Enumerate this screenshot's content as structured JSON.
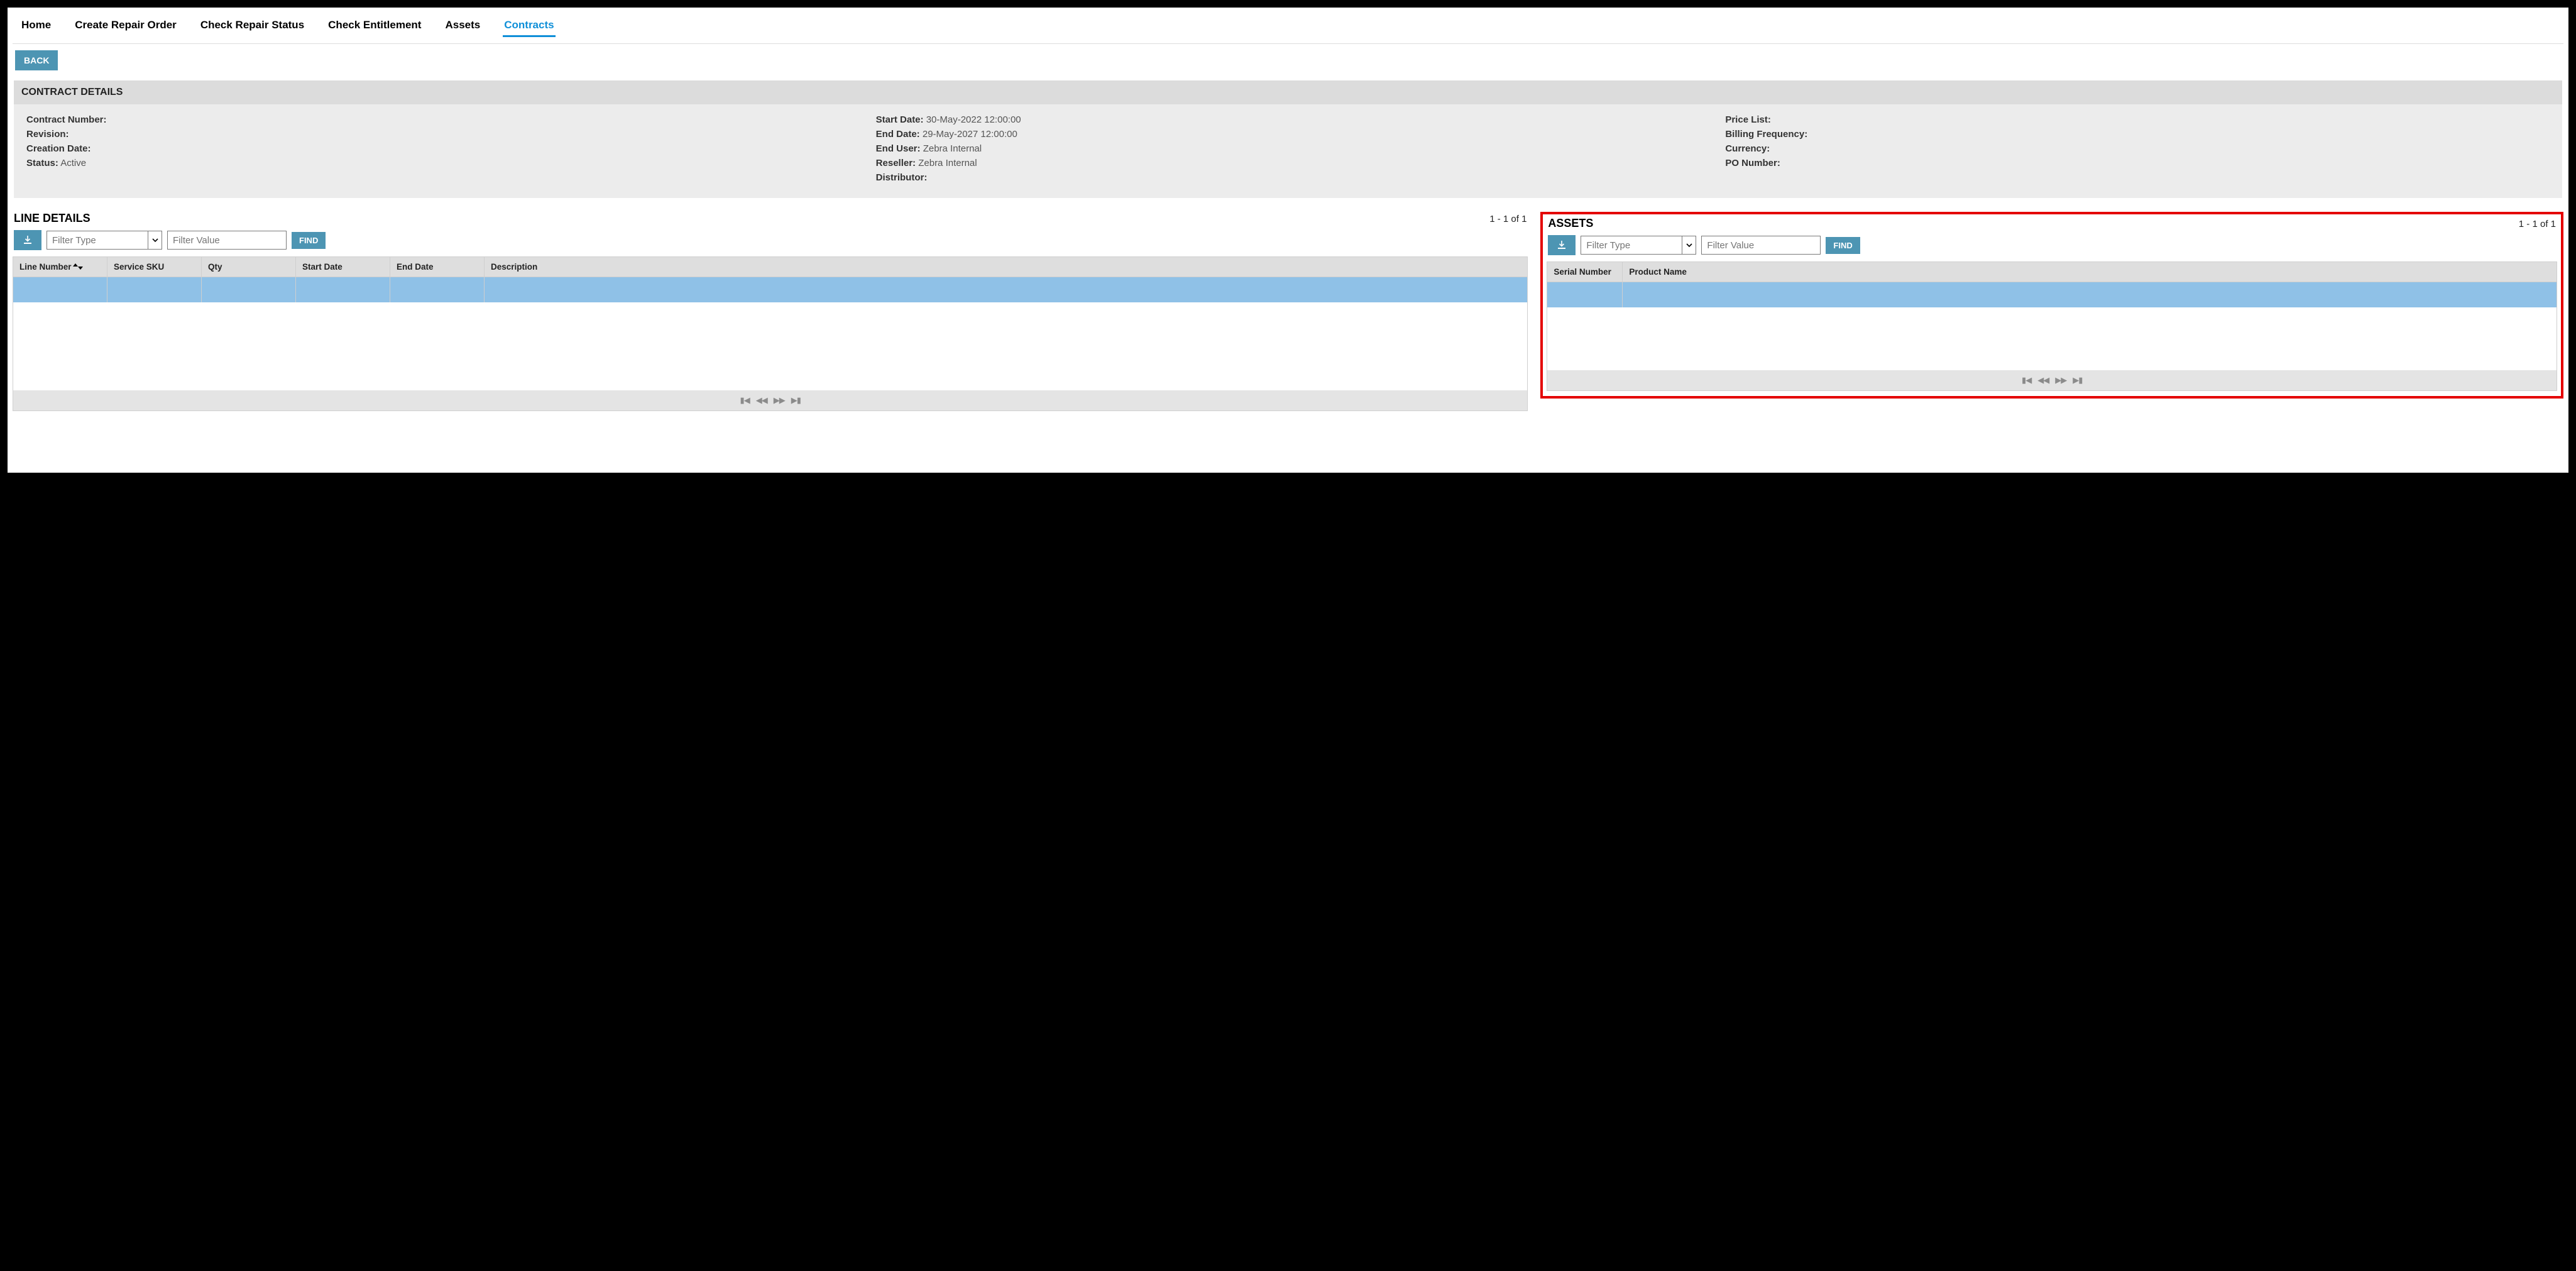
{
  "nav": {
    "items": [
      "Home",
      "Create Repair Order",
      "Check Repair Status",
      "Check Entitlement",
      "Assets",
      "Contracts"
    ],
    "active_index": 5
  },
  "back_label": "BACK",
  "details": {
    "header": "CONTRACT DETAILS",
    "col1": [
      {
        "label": "Contract Number:",
        "value": ""
      },
      {
        "label": "Revision:",
        "value": ""
      },
      {
        "label": "Creation Date:",
        "value": ""
      },
      {
        "label": "Status:",
        "value": "Active"
      }
    ],
    "col2": [
      {
        "label": "Start Date:",
        "value": "30-May-2022 12:00:00"
      },
      {
        "label": "End Date:",
        "value": "29-May-2027 12:00:00"
      },
      {
        "label": "End User:",
        "value": "Zebra Internal"
      },
      {
        "label": "Reseller:",
        "value": "Zebra Internal"
      },
      {
        "label": "Distributor:",
        "value": ""
      }
    ],
    "col3": [
      {
        "label": "Price List:",
        "value": ""
      },
      {
        "label": "Billing Frequency:",
        "value": ""
      },
      {
        "label": "Currency:",
        "value": ""
      },
      {
        "label": "PO Number:",
        "value": ""
      }
    ]
  },
  "line_details": {
    "title": "LINE DETAILS",
    "count": "1 - 1 of 1",
    "filter_type_placeholder": "Filter Type",
    "filter_value_placeholder": "Filter Value",
    "find_label": "FIND",
    "columns": [
      "Line Number",
      "Service SKU",
      "Qty",
      "Start Date",
      "End Date",
      "Description"
    ],
    "sorted_column_index": 0,
    "rows": [
      {
        "cells": [
          "",
          "",
          "",
          "",
          "",
          ""
        ],
        "selected": true
      }
    ]
  },
  "assets": {
    "title": "ASSETS",
    "count": "1 - 1 of 1",
    "filter_type_placeholder": "Filter Type",
    "filter_value_placeholder": "Filter Value",
    "find_label": "FIND",
    "columns": [
      "Serial Number",
      "Product Name"
    ],
    "rows": [
      {
        "cells": [
          "",
          ""
        ],
        "selected": true
      }
    ]
  },
  "colors": {
    "accent": "#0f8fd8",
    "button": "#4d95b3",
    "highlight_border": "#e40000",
    "row_selected": "#8fc1e7"
  }
}
